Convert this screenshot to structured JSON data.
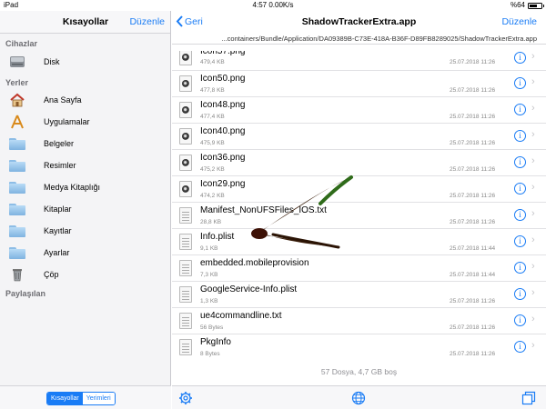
{
  "status": {
    "device": "iPad",
    "time_speed": "4:57 0.00K/s",
    "battery_text": "%64",
    "battery_level": 0.64
  },
  "sidebar": {
    "title": "Kısayollar",
    "edit": "Düzenle",
    "sections": {
      "devices": "Cihazlar",
      "places": "Yerler",
      "shared": "Paylaşılan"
    },
    "disk_label": "Disk",
    "places": [
      {
        "label": "Ana Sayfa",
        "icon": "home-icon"
      },
      {
        "label": "Uygulamalar",
        "icon": "applications-icon"
      },
      {
        "label": "Belgeler",
        "icon": "folder-icon"
      },
      {
        "label": "Resimler",
        "icon": "folder-icon"
      },
      {
        "label": "Medya Kitaplığı",
        "icon": "folder-icon"
      },
      {
        "label": "Kitaplar",
        "icon": "folder-icon"
      },
      {
        "label": "Kayıtlar",
        "icon": "folder-icon"
      },
      {
        "label": "Ayarlar",
        "icon": "folder-icon"
      },
      {
        "label": "Çöp",
        "icon": "trash-icon"
      }
    ],
    "segment": {
      "shortcuts": "Kısayollar",
      "locations": "Yerimleri"
    }
  },
  "main": {
    "back": "Geri",
    "title": "ShadowTrackerExtra.app",
    "edit": "Düzenle",
    "path": "...containers/Bundle/Application/DA09389B-C73E-418A-B36F-D89FB8289025/ShadowTrackerExtra.app",
    "files": [
      {
        "name": "Icon57.png",
        "size": "479,4 KB",
        "date": "25.07.2018 11:26",
        "type": "image"
      },
      {
        "name": "Icon50.png",
        "size": "477,8 KB",
        "date": "25.07.2018 11:26",
        "type": "image"
      },
      {
        "name": "Icon48.png",
        "size": "477,4 KB",
        "date": "25.07.2018 11:26",
        "type": "image"
      },
      {
        "name": "Icon40.png",
        "size": "475,9 KB",
        "date": "25.07.2018 11:26",
        "type": "image"
      },
      {
        "name": "Icon36.png",
        "size": "475,2 KB",
        "date": "25.07.2018 11:26",
        "type": "image"
      },
      {
        "name": "Icon29.png",
        "size": "474,2 KB",
        "date": "25.07.2018 11:26",
        "type": "image"
      },
      {
        "name": "Manifest_NonUFSFiles_IOS.txt",
        "size": "28,8 KB",
        "date": "25.07.2018 11:26",
        "type": "doc"
      },
      {
        "name": "Info.plist",
        "size": "9,1 KB",
        "date": "25.07.2018 11:44",
        "type": "doc"
      },
      {
        "name": "embedded.mobileprovision",
        "size": "7,3 KB",
        "date": "25.07.2018 11:44",
        "type": "doc"
      },
      {
        "name": "GoogleService-Info.plist",
        "size": "1,3 KB",
        "date": "25.07.2018 11:26",
        "type": "doc"
      },
      {
        "name": "ue4commandline.txt",
        "size": "56 Bytes",
        "date": "25.07.2018 11:26",
        "type": "doc"
      },
      {
        "name": "PkgInfo",
        "size": "8 Bytes",
        "date": "25.07.2018 11:26",
        "type": "doc"
      }
    ],
    "count": "57 Dosya, 4,7 GB boş"
  },
  "toolbar_icons": [
    "settings-gear-icon",
    "globe-icon",
    "windows-icon"
  ],
  "colors": {
    "accent": "#1a7cf5",
    "arrow": "#3a1e0a"
  }
}
